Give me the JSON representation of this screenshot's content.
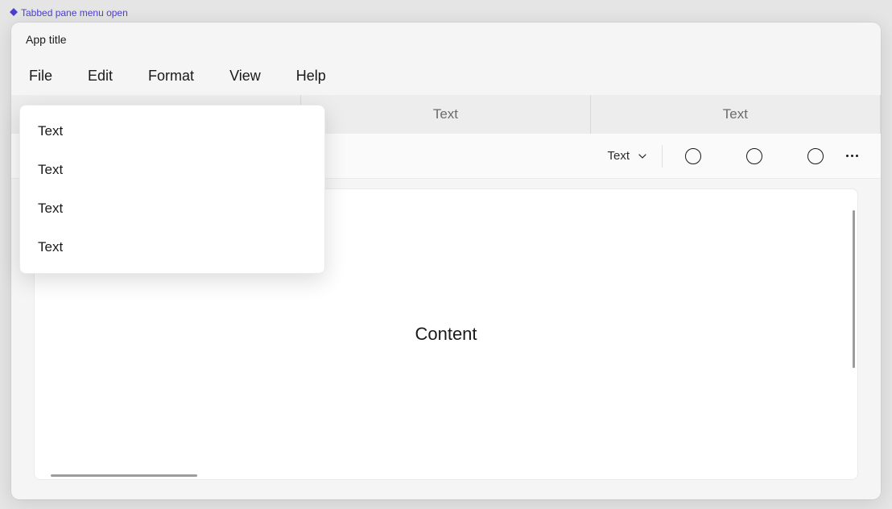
{
  "dev_label": "Tabbed pane menu open",
  "app_title": "App title",
  "menubar": {
    "file": "File",
    "edit": "Edit",
    "format": "Format",
    "view": "View",
    "help": "Help"
  },
  "tabs": {
    "tab1": "Text",
    "tab2": "Text",
    "tab3": "Text"
  },
  "toolbar": {
    "dropdown_label": "Text"
  },
  "content": {
    "label": "Content"
  },
  "flyout": {
    "item1": "Text",
    "item2": "Text",
    "item3": "Text",
    "item4": "Text"
  }
}
